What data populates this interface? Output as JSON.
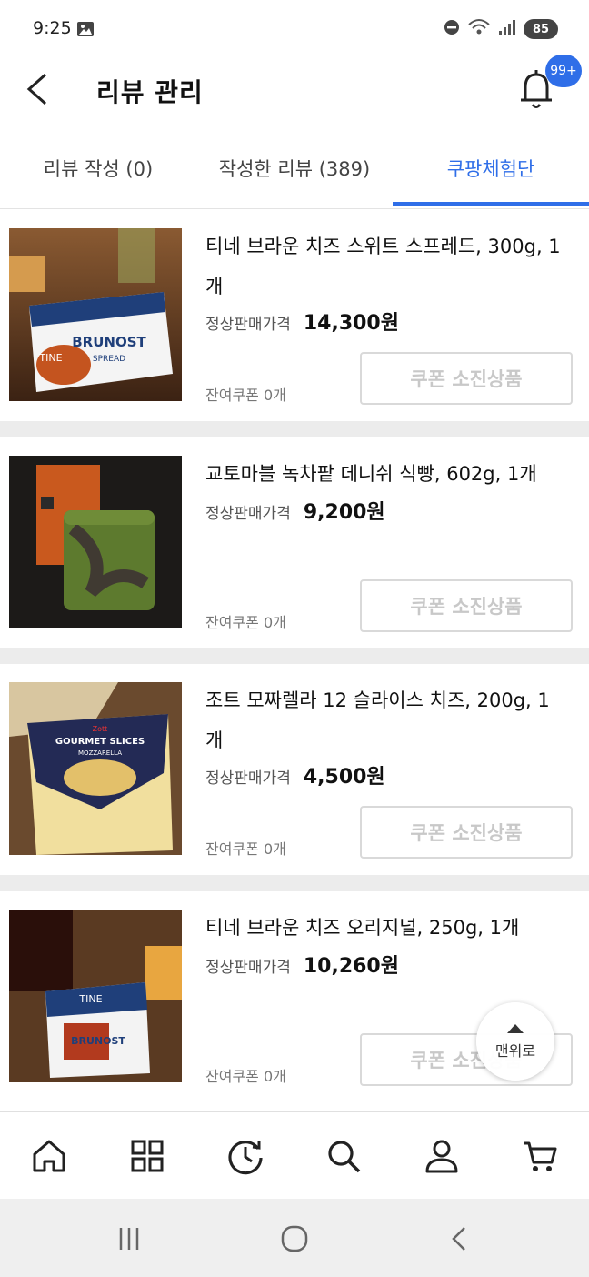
{
  "status_bar": {
    "time": "9:25",
    "battery": "85"
  },
  "header": {
    "title": "리뷰 관리",
    "badge": "99+"
  },
  "tabs": [
    {
      "label": "리뷰 작성 (0)",
      "active": false
    },
    {
      "label": "작성한 리뷰 (389)",
      "active": false
    },
    {
      "label": "쿠팡체험단",
      "active": true
    }
  ],
  "products": [
    {
      "name": "티네 브라운 치즈 스위트 스프레드, 300g, 1개",
      "price_label": "정상판매가격",
      "price": "14,300원",
      "coupon_left": "잔여쿠폰 0개",
      "button": "쿠폰 소진상품"
    },
    {
      "name": "교토마블 녹차팥 데니쉬 식빵, 602g, 1개",
      "price_label": "정상판매가격",
      "price": "9,200원",
      "coupon_left": "잔여쿠폰 0개",
      "button": "쿠폰 소진상품"
    },
    {
      "name": "조트 모짜렐라 12 슬라이스 치즈, 200g, 1개",
      "price_label": "정상판매가격",
      "price": "4,500원",
      "coupon_left": "잔여쿠폰 0개",
      "button": "쿠폰 소진상품"
    },
    {
      "name": "티네 브라운 치즈 오리지널, 250g, 1개",
      "price_label": "정상판매가격",
      "price": "10,260원",
      "coupon_left": "잔여쿠폰 0개",
      "button": "쿠폰 소진상품"
    }
  ],
  "thumb_text": {
    "p0": [
      "TINE",
      "BRUNOST",
      "SPREAD"
    ],
    "p1": [],
    "p2": [
      "Zott",
      "GOURMET SLICES",
      "MOZZARELLA"
    ],
    "p3": [
      "TINE",
      "BRUNOST"
    ]
  },
  "to_top": {
    "label": "맨위로"
  },
  "colors": {
    "accent": "#2f6ee8",
    "divider": "#ececec",
    "disabled_text": "#c8c8c8"
  },
  "bottom_nav": [
    "home-icon",
    "category-icon",
    "recent-icon",
    "search-icon",
    "user-icon",
    "cart-icon"
  ],
  "system_nav": [
    "recent-apps-icon",
    "home-circle-icon",
    "back-icon"
  ]
}
